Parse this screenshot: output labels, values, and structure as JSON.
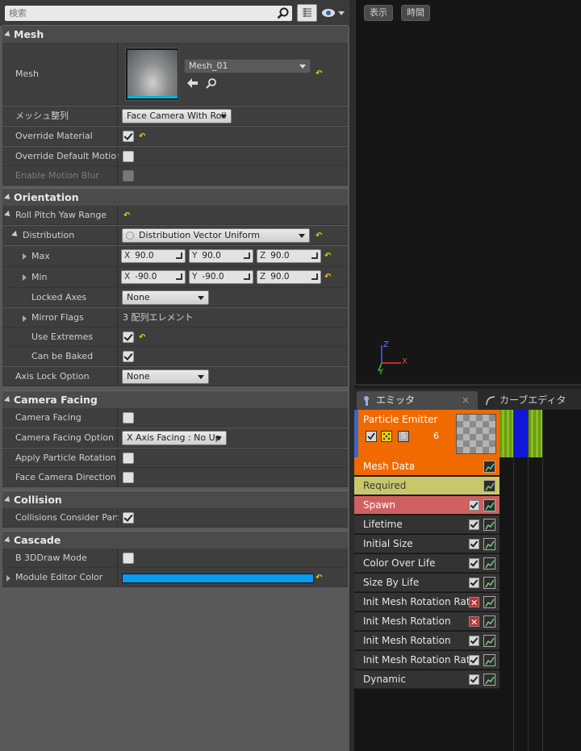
{
  "search": {
    "placeholder": "検索"
  },
  "icons": {
    "search": "search-icon",
    "grid": "grid-view-icon",
    "eye": "eye-visibility-icon",
    "reset": "reset-to-default-icon",
    "back": "arrow-left-icon",
    "browse": "magnify-icon"
  },
  "mesh_section": {
    "title": "Mesh",
    "mesh_label": "Mesh",
    "mesh_value": "Mesh_01",
    "alignment_label": "メッシュ整列",
    "alignment_value": "Face Camera With Roll",
    "override_material_label": "Override Material",
    "override_material_checked": true,
    "override_motion_label": "Override Default Motion B",
    "override_motion_checked": false,
    "enable_motion_blur_label": "Enable Motion Blur",
    "enable_motion_blur_checked": false
  },
  "orientation": {
    "title": "Orientation",
    "range_label": "Roll Pitch Yaw Range",
    "distribution_label": "Distribution",
    "distribution_value": "Distribution Vector Uniform",
    "max_label": "Max",
    "max": {
      "x": "90.0",
      "y": "90.0",
      "z": "90.0"
    },
    "min_label": "Min",
    "min": {
      "x": "-90.0",
      "y": "-90.0",
      "z": "90.0"
    },
    "axis_keys": {
      "x": "X",
      "y": "Y",
      "z": "Z"
    },
    "locked_axes_label": "Locked Axes",
    "locked_axes_value": "None",
    "mirror_flags_label": "Mirror Flags",
    "mirror_flags_value": "3 配列エレメント",
    "use_extremes_label": "Use Extremes",
    "use_extremes_checked": true,
    "can_be_baked_label": "Can be Baked",
    "can_be_baked_checked": true,
    "axis_lock_label": "Axis Lock Option",
    "axis_lock_value": "None"
  },
  "camera_facing": {
    "title": "Camera Facing",
    "camera_facing_label": "Camera Facing",
    "camera_facing_option_label": "Camera Facing Option",
    "camera_facing_option_value": "X Axis Facing : No Up",
    "apply_rotation_label": "Apply Particle Rotation as",
    "face_direction_label": "Face Camera Direction Ra"
  },
  "collision": {
    "title": "Collision",
    "consider_label": "Collisions Consider Partil",
    "consider_checked": true
  },
  "cascade": {
    "title": "Cascade",
    "draw_mode_label": "B 3DDraw Mode",
    "editor_color_label": "Module Editor Color",
    "editor_color": "#0a9bf0"
  },
  "viewport": {
    "show_btn": "表示",
    "time_btn": "時間",
    "axis_x": "X",
    "axis_z": "Z",
    "axis_y": "Y"
  },
  "tabs": {
    "emitter": "エミッタ",
    "curve_editor": "カーブエディタ",
    "close": "×"
  },
  "emitter": {
    "name": "Particle Emitter",
    "count": "6",
    "solo": "S",
    "header_color": "#f06a00",
    "modules": [
      {
        "label": "Mesh Data",
        "color": "#f06a00",
        "text": "#ffffff",
        "check": "none"
      },
      {
        "label": "Required",
        "color": "#c8c86a",
        "text": "#3a3a3a",
        "check": "none"
      },
      {
        "label": "Spawn",
        "color": "#d06060",
        "text": "#ffffff",
        "check": "on"
      },
      {
        "label": "Lifetime",
        "color": "#333333",
        "text": "#e6e6e6",
        "check": "on"
      },
      {
        "label": "Initial Size",
        "color": "#333333",
        "text": "#e6e6e6",
        "check": "on"
      },
      {
        "label": "Color Over Life",
        "color": "#333333",
        "text": "#e6e6e6",
        "check": "on"
      },
      {
        "label": "Size By Life",
        "color": "#333333",
        "text": "#e6e6e6",
        "check": "on"
      },
      {
        "label": "Init Mesh Rotation Rate",
        "color": "#333333",
        "text": "#e6e6e6",
        "check": "x"
      },
      {
        "label": "Init Mesh Rotation",
        "color": "#333333",
        "text": "#e6e6e6",
        "check": "x"
      },
      {
        "label": "Init Mesh Rotation",
        "color": "#333333",
        "text": "#e6e6e6",
        "check": "on"
      },
      {
        "label": "Init Mesh Rotation Rate",
        "color": "#333333",
        "text": "#e6e6e6",
        "check": "on"
      },
      {
        "label": "Dynamic",
        "color": "#333333",
        "text": "#e6e6e6",
        "check": "on"
      }
    ]
  }
}
